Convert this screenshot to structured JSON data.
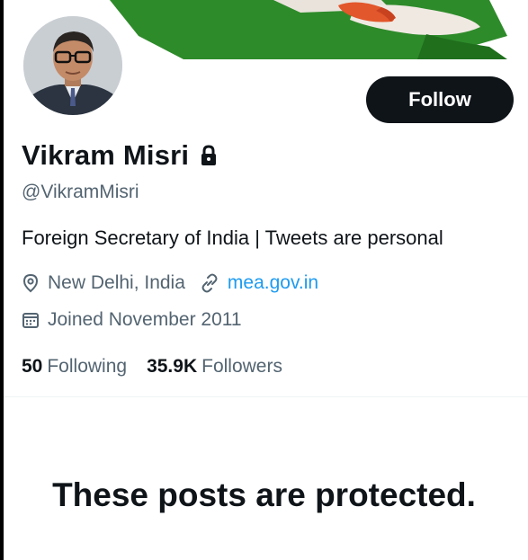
{
  "profile": {
    "name": "Vikram Misri",
    "handle": "@VikramMisri",
    "bio": "Foreign Secretary of India | Tweets are personal",
    "location": "New Delhi, India",
    "website": "mea.gov.in",
    "joined": "Joined November 2011",
    "locked": true
  },
  "actions": {
    "follow_label": "Follow"
  },
  "stats": {
    "following_count": "50",
    "following_label": "Following",
    "followers_count": "35.9K",
    "followers_label": "Followers"
  },
  "protected_notice": {
    "title": "These posts are protected."
  },
  "icons": {
    "lock": "lock-icon",
    "location": "location-pin-icon",
    "link": "link-icon",
    "calendar": "calendar-icon"
  },
  "colors": {
    "primary_text": "#0f1419",
    "secondary_text": "#536471",
    "link": "#1d9bf0",
    "button_bg": "#0f1419",
    "banner_green": "#2e8b2a"
  }
}
